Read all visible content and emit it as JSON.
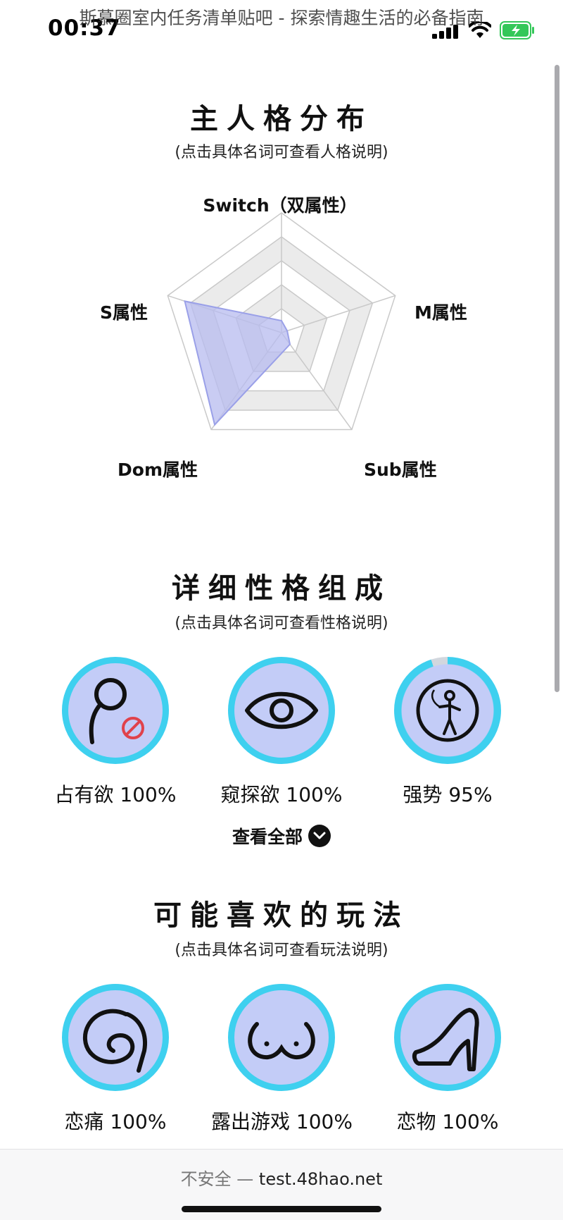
{
  "status_bar": {
    "time": "00:37",
    "overlay_title": "斯慕圈室内任务清单贴吧 - 探索情趣生活的必备指南"
  },
  "colors": {
    "badge_fill": "#c3ccf7",
    "badge_ring": "#3ed0ef",
    "radar_fill": "#b7bbef",
    "battery_green": "#34c759"
  },
  "section1": {
    "title": "主人格分布",
    "subtitle": "(点击具体名词可查看人格说明)"
  },
  "radar": {
    "axes": [
      "Switch（双属性）",
      "M属性",
      "Sub属性",
      "Dom属性",
      "S属性"
    ],
    "values": [
      0.1,
      0.05,
      0.12,
      0.95,
      0.85
    ],
    "levels": 5
  },
  "section2": {
    "title": "详细性格组成",
    "subtitle": "(点击具体名词可查看性格说明)",
    "items": [
      {
        "label": "占有欲 100%",
        "icon": "possessive-icon",
        "progress": 1.0
      },
      {
        "label": "窥探欲 100%",
        "icon": "eye-icon",
        "progress": 1.0
      },
      {
        "label": "强势 95%",
        "icon": "whip-figure-icon",
        "progress": 0.95
      }
    ],
    "view_all": "查看全部"
  },
  "section3": {
    "title": "可能喜欢的玩法",
    "subtitle": "(点击具体名词可查看玩法说明)",
    "items": [
      {
        "label": "恋痛 100%",
        "icon": "whip-icon"
      },
      {
        "label": "露出游戏 100%",
        "icon": "chest-icon"
      },
      {
        "label": "恋物 100%",
        "icon": "high-heel-icon"
      }
    ]
  },
  "browser": {
    "insecure": "不安全",
    "separator": "—",
    "url": "test.48hao.net"
  }
}
